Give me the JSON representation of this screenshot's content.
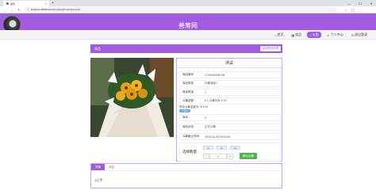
{
  "browser": {
    "tab_title": "首页",
    "url": "localhost:8080/chuanhouwang/front/index.html"
  },
  "site": {
    "title": "善筹网"
  },
  "nav": {
    "items": [
      {
        "label": "首页",
        "icon": "home-icon",
        "active": false
      },
      {
        "label": "商品",
        "icon": "grid-icon",
        "active": false
      },
      {
        "label": "公告",
        "icon": "bell-icon",
        "active": true
      },
      {
        "label": "个人中心",
        "icon": "user-icon",
        "active": false
      },
      {
        "label": "退出登录",
        "icon": "logout-icon",
        "active": false
      }
    ]
  },
  "breadcrumb": {
    "label": "商品"
  },
  "back_button": {
    "label": "返回商品列表"
  },
  "product": {
    "name": "测试",
    "fields": [
      {
        "label": "商品编号:",
        "value": "1745040948728"
      },
      {
        "label": "商品类型:",
        "value": "众筹商品1"
      },
      {
        "label": "商品数量:",
        "value": "1"
      },
      {
        "label": "众筹金额:",
        "value": "¥ 1 众筹目标 ¥ 10"
      },
      {
        "label": "库存:",
        "value": "9"
      },
      {
        "label": "商品状态:",
        "value": "正在众筹"
      },
      {
        "label": "众筹截止时间:",
        "value": "2025-04-25 00:00:00"
      }
    ],
    "warning_text": "剩余众筹金额为: ¥ 9.00",
    "tag": "众筹中"
  },
  "purchase": {
    "qty_label": "选择数量:",
    "chips": [
      "10",
      "50",
      "100"
    ],
    "minus": "-",
    "plus": "+",
    "quantity": "1",
    "buy_label": "确认众筹"
  },
  "tabs": {
    "items": [
      {
        "label": "详情",
        "active": true
      },
      {
        "label": "评论",
        "active": false
      }
    ],
    "content": "1二手"
  }
}
